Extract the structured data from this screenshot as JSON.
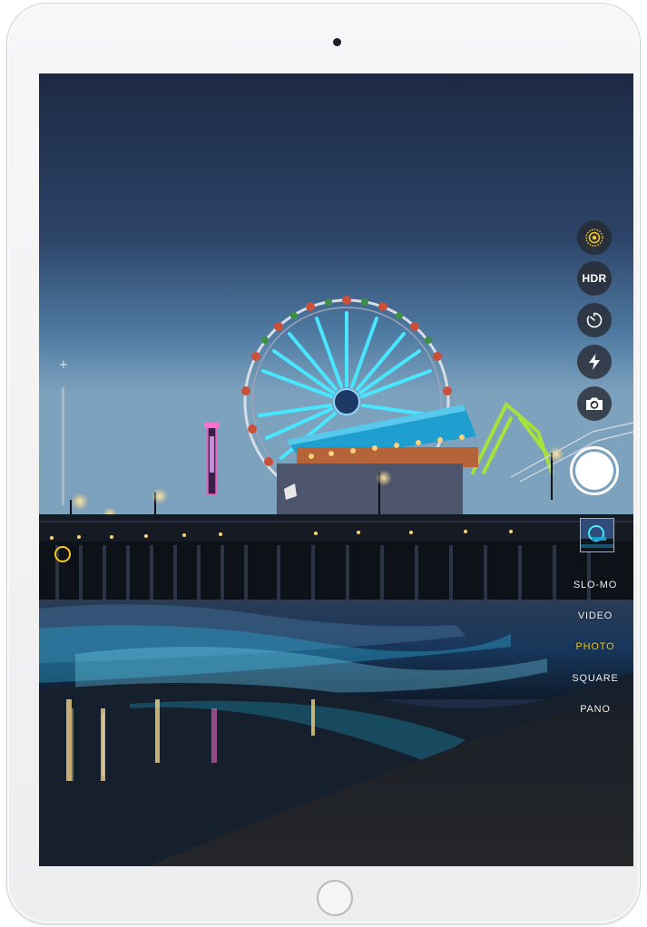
{
  "device": {
    "model": "iPad"
  },
  "camera": {
    "controls": [
      {
        "name": "live-photo",
        "icon": "live-photo-icon"
      },
      {
        "name": "hdr",
        "label": "HDR"
      },
      {
        "name": "timer",
        "icon": "timer-icon"
      },
      {
        "name": "flash",
        "icon": "flash-icon"
      },
      {
        "name": "switch-camera",
        "icon": "switch-camera-icon"
      }
    ],
    "modes": [
      "SLO-MO",
      "VIDEO",
      "PHOTO",
      "SQUARE",
      "PANO"
    ],
    "selected_mode": "PHOTO",
    "zoom": {
      "plus_label": "+"
    }
  },
  "colors": {
    "accent_yellow": "#f6c623",
    "control_bg": "#26282f",
    "device_frame": "#f2f2f3"
  }
}
